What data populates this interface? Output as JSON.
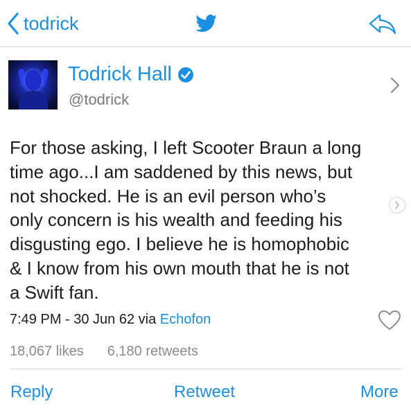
{
  "nav": {
    "back_label": "todrick",
    "colors": {
      "accent": "#1d8fe0"
    }
  },
  "profile": {
    "display_name": "Todrick Hall",
    "handle": "@todrick",
    "verified": true
  },
  "tweet": {
    "text": "For those asking, I left Scooter Braun a long\ntime ago...I am saddened by this news, but\nnot shocked. He is an evil person who’s\nonly concern is his wealth and feeding his\ndisgusting ego. I believe he is homophobic\n& I know from his own mouth that he is not\na Swift fan.",
    "timestamp": "7:49 PM - 30 Jun 62 via",
    "via": "Echofon",
    "likes": "18,067 likes",
    "retweets": "6,180 retweets"
  },
  "actions": {
    "reply": "Reply",
    "retweet": "Retweet",
    "more": "More"
  },
  "icons": [
    "back-chevron-icon",
    "twitter-bird-icon",
    "share-icon",
    "verified-badge-icon",
    "chevron-right-icon",
    "carousel-next-icon",
    "heart-icon"
  ]
}
